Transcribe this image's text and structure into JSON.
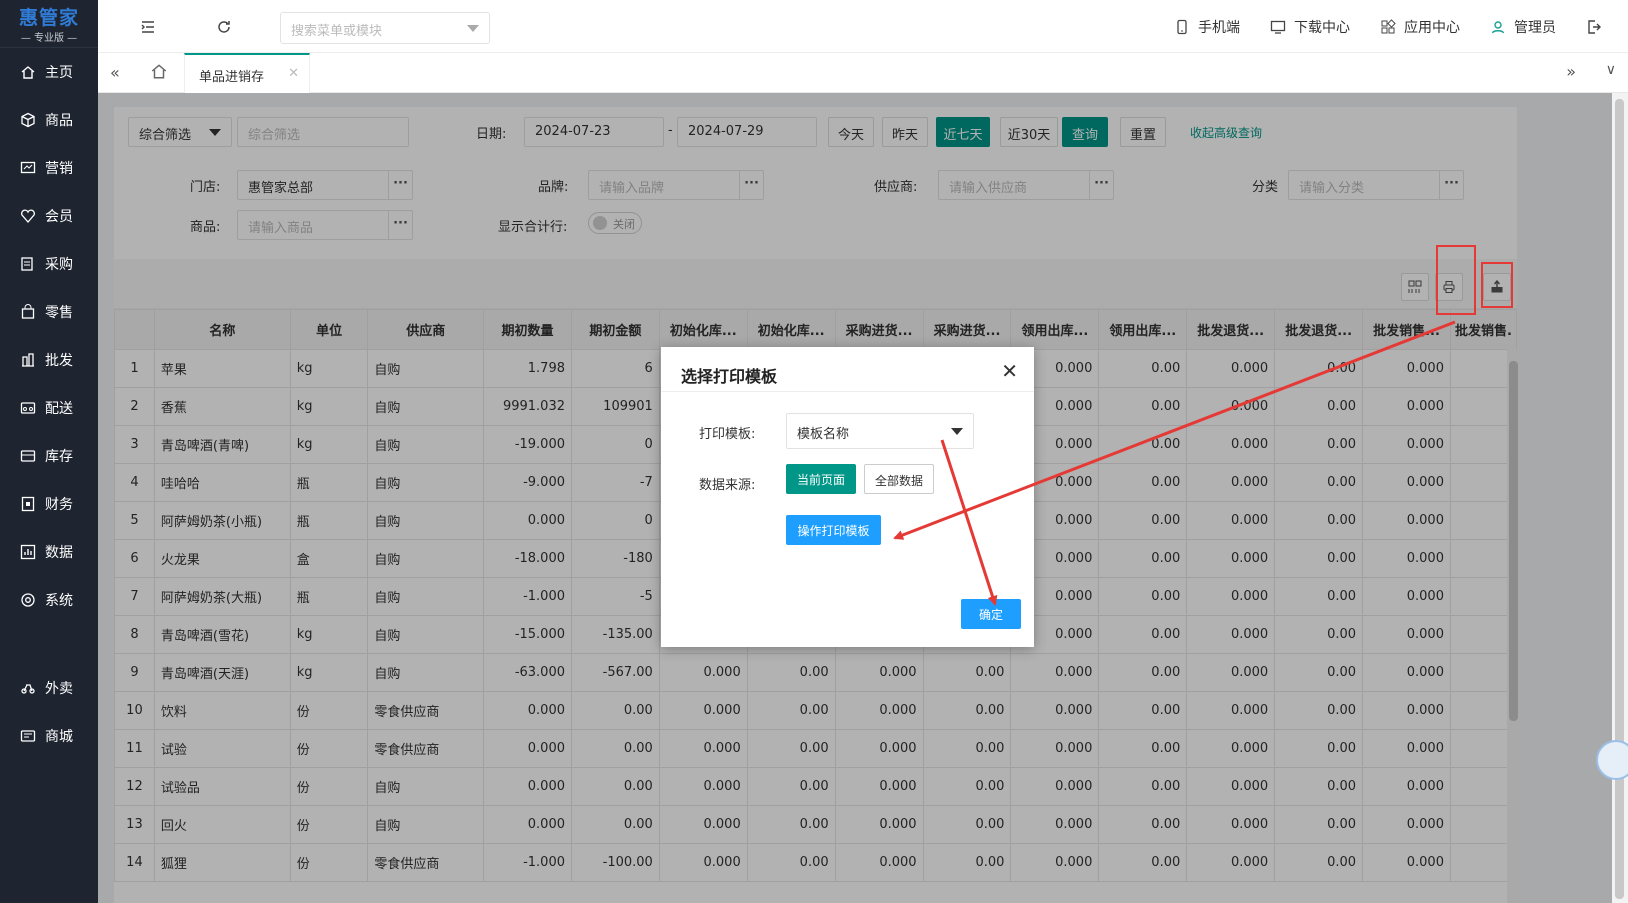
{
  "brand": {
    "name": "惠管家",
    "edition": "专业版"
  },
  "sidebar": {
    "items": [
      {
        "label": "主页",
        "icon": "home-icon"
      },
      {
        "label": "商品",
        "icon": "box-icon"
      },
      {
        "label": "营销",
        "icon": "marketing-icon"
      },
      {
        "label": "会员",
        "icon": "member-icon"
      },
      {
        "label": "采购",
        "icon": "purchase-icon"
      },
      {
        "label": "零售",
        "icon": "retail-icon"
      },
      {
        "label": "批发",
        "icon": "wholesale-icon"
      },
      {
        "label": "配送",
        "icon": "delivery-icon"
      },
      {
        "label": "库存",
        "icon": "inventory-icon"
      },
      {
        "label": "财务",
        "icon": "finance-icon"
      },
      {
        "label": "数据",
        "icon": "data-icon"
      },
      {
        "label": "系统",
        "icon": "system-icon"
      },
      {
        "label": "外卖",
        "icon": "takeout-icon"
      },
      {
        "label": "商城",
        "icon": "mall-icon"
      }
    ]
  },
  "topbar": {
    "search_placeholder": "搜索菜单或模块",
    "mobile": "手机端",
    "download": "下载中心",
    "apps": "应用中心",
    "user": "管理员"
  },
  "tabs": {
    "active": "单品进销存"
  },
  "filters": {
    "combo_select": "综合筛选",
    "combo_placeholder": "综合筛选",
    "date_label": "日期:",
    "date_from": "2024-07-23",
    "date_sep": "-",
    "date_to": "2024-07-29",
    "btn_today": "今天",
    "btn_yesterday": "昨天",
    "btn_7days": "近七天",
    "btn_30days": "近30天",
    "btn_query": "查询",
    "btn_reset": "重置",
    "collapse_link": "收起高级查询",
    "store_label": "门店:",
    "store_value": "惠管家总部",
    "brand_label": "品牌:",
    "brand_placeholder": "请输入品牌",
    "supplier_label": "供应商:",
    "supplier_placeholder": "请输入供应商",
    "category_label": "分类",
    "category_placeholder": "请输入分类",
    "product_label": "商品:",
    "product_placeholder": "请输入商品",
    "show_total_label": "显示合计行:",
    "show_total_toggle": "关闭"
  },
  "table": {
    "columns": [
      "",
      "名称",
      "单位",
      "供应商",
      "期初数量",
      "期初金额",
      "初始化库...",
      "初始化库...",
      "采购进货...",
      "采购进货...",
      "领用出库...",
      "领用出库...",
      "批发退货...",
      "批发退货...",
      "批发销售...",
      "批发销售."
    ],
    "rows": [
      [
        "1",
        "苹果",
        "kg",
        "自购",
        "1.798",
        "6",
        "",
        "",
        "",
        "00",
        "0.000",
        "0.00",
        "0.000",
        "0.00",
        "0.000",
        ""
      ],
      [
        "2",
        "香蕉",
        "kg",
        "自购",
        "9991.032",
        "109901",
        "",
        "",
        "",
        "00",
        "0.000",
        "0.00",
        "0.000",
        "0.00",
        "0.000",
        ""
      ],
      [
        "3",
        "青岛啤酒(青啤)",
        "kg",
        "自购",
        "-19.000",
        "0",
        "",
        "",
        "",
        "00",
        "0.000",
        "0.00",
        "0.000",
        "0.00",
        "0.000",
        ""
      ],
      [
        "4",
        "哇哈哈",
        "瓶",
        "自购",
        "-9.000",
        "-7",
        "",
        "",
        "",
        "00",
        "0.000",
        "0.00",
        "0.000",
        "0.00",
        "0.000",
        ""
      ],
      [
        "5",
        "阿萨姆奶茶(小瓶)",
        "瓶",
        "自购",
        "0.000",
        "0",
        "",
        "",
        "",
        "00",
        "0.000",
        "0.00",
        "0.000",
        "0.00",
        "0.000",
        ""
      ],
      [
        "6",
        "火龙果",
        "盒",
        "自购",
        "-18.000",
        "-180",
        "",
        "",
        "",
        "00",
        "0.000",
        "0.00",
        "0.000",
        "0.00",
        "0.000",
        ""
      ],
      [
        "7",
        "阿萨姆奶茶(大瓶)",
        "瓶",
        "自购",
        "-1.000",
        "-5",
        "",
        "",
        "",
        "00",
        "0.000",
        "0.00",
        "0.000",
        "0.00",
        "0.000",
        ""
      ],
      [
        "8",
        "青岛啤酒(雪花)",
        "kg",
        "自购",
        "-15.000",
        "-135.00",
        "0.000",
        "0.00",
        "0.000",
        "0.00",
        "0.000",
        "0.00",
        "0.000",
        "0.00",
        "0.000",
        ""
      ],
      [
        "9",
        "青岛啤酒(天涯)",
        "kg",
        "自购",
        "-63.000",
        "-567.00",
        "0.000",
        "0.00",
        "0.000",
        "0.00",
        "0.000",
        "0.00",
        "0.000",
        "0.00",
        "0.000",
        ""
      ],
      [
        "10",
        "饮料",
        "份",
        "零食供应商",
        "0.000",
        "0.00",
        "0.000",
        "0.00",
        "0.000",
        "0.00",
        "0.000",
        "0.00",
        "0.000",
        "0.00",
        "0.000",
        ""
      ],
      [
        "11",
        "试验",
        "份",
        "零食供应商",
        "0.000",
        "0.00",
        "0.000",
        "0.00",
        "0.000",
        "0.00",
        "0.000",
        "0.00",
        "0.000",
        "0.00",
        "0.000",
        ""
      ],
      [
        "12",
        "试验品",
        "份",
        "自购",
        "0.000",
        "0.00",
        "0.000",
        "0.00",
        "0.000",
        "0.00",
        "0.000",
        "0.00",
        "0.000",
        "0.00",
        "0.000",
        ""
      ],
      [
        "13",
        "回火",
        "份",
        "自购",
        "0.000",
        "0.00",
        "0.000",
        "0.00",
        "0.000",
        "0.00",
        "0.000",
        "0.00",
        "0.000",
        "0.00",
        "0.000",
        ""
      ],
      [
        "14",
        "狐狸",
        "份",
        "零食供应商",
        "-1.000",
        "-100.00",
        "0.000",
        "0.00",
        "0.000",
        "0.00",
        "0.000",
        "0.00",
        "0.000",
        "0.00",
        "0.000",
        ""
      ]
    ]
  },
  "modal": {
    "title": "选择打印模板",
    "template_label": "打印模板:",
    "template_value": "模板名称",
    "source_label": "数据来源:",
    "btn_current_page": "当前页面",
    "btn_all_data": "全部数据",
    "btn_operate_template": "操作打印模板",
    "btn_confirm": "确定"
  },
  "colors": {
    "sidebar_bg": "#1f2530",
    "brand_blue": "#2f7bd6",
    "accent_green": "#009688",
    "primary_blue": "#1e9fff",
    "alert_red": "#e53935"
  }
}
